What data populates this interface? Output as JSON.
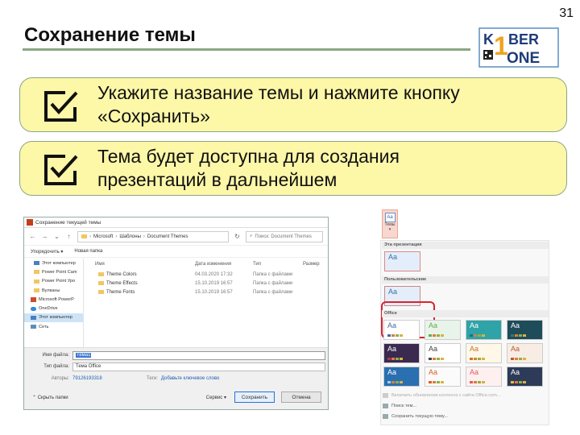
{
  "slide": {
    "number": "31",
    "title": "Сохранение темы"
  },
  "logo": {
    "line1": "KIBER",
    "line2": "ONE",
    "digit": "1"
  },
  "callouts": [
    {
      "line1": "Укажите название темы и нажмите кнопку",
      "line2": "«Сохранить»"
    },
    {
      "line1": "Тема будет доступна для создания",
      "line2": "презентаций в дальнейшем"
    }
  ],
  "dialog": {
    "title": "Сохранение текущей темы",
    "path": [
      "Microsoft",
      "Шаблоны",
      "Document Themes"
    ],
    "search_placeholder": "Поиск: Document Themes",
    "toolbar": {
      "organize": "Упорядочить ▾",
      "new_folder": "Новая папка"
    },
    "sidebar": [
      {
        "label": "Этот компьютер",
        "icon": "pc-icon"
      },
      {
        "label": "Power Point Cam",
        "icon": "folder-icon"
      },
      {
        "label": "Power Point Уро",
        "icon": "folder-icon"
      },
      {
        "label": "Вулканы",
        "icon": "folder-icon"
      },
      {
        "label": "Microsoft PowerP",
        "icon": "powerpoint-icon"
      },
      {
        "label": "OneDrive",
        "icon": "cloud-icon"
      },
      {
        "label": "Этот компьютер",
        "icon": "pc-icon",
        "selected": true
      },
      {
        "label": "Сеть",
        "icon": "network-icon"
      }
    ],
    "columns": {
      "name": "Имя",
      "date": "Дата изменения",
      "type": "Тип",
      "size": "Размер"
    },
    "files": [
      {
        "name": "Theme Colors",
        "date": "04.03.2020 17:32",
        "type": "Папка с файлами"
      },
      {
        "name": "Theme Effects",
        "date": "15.10.2019 16:57",
        "type": "Папка с файлами"
      },
      {
        "name": "Theme Fonts",
        "date": "15.10.2019 16:57",
        "type": "Папка с файлами"
      }
    ],
    "filename_label": "Имя файла:",
    "filename_value": "Тема1",
    "filetype_label": "Тип файла:",
    "filetype_value": "Тема Office",
    "authors_label": "Авторы:",
    "authors_value": "79126193318",
    "tags_label": "Теги:",
    "tags_value": "Добавьте ключевое слово",
    "hide_folders": "Скрыть папки",
    "service": "Сервис ▾",
    "save": "Сохранить",
    "cancel": "Отмена"
  },
  "themes_panel": {
    "button_label": "Темы",
    "aa": "Aa",
    "sections": {
      "current": "Эта презентация",
      "custom": "Пользовательские",
      "office": "Office"
    },
    "commands": {
      "refresh": "Включить обновления контента с сайта Office.com...",
      "browse": "Поиск тем...",
      "save": "Сохранить текущую тему..."
    },
    "office_theme_colors": [
      [
        "#ffffff",
        "#3b6ea5"
      ],
      [
        "#e8f4ea",
        "#6aa84f"
      ],
      [
        "#2ea3a8",
        "#1c6e8c"
      ],
      [
        "#1e4c5a",
        "#2e7d6e"
      ],
      [
        "#3b2a4f",
        "#b0335d"
      ],
      [
        "#ffffff",
        "#444444"
      ],
      [
        "#fff7e8",
        "#c07a2e"
      ],
      [
        "#f8ede4",
        "#b85c2c"
      ],
      [
        "#2a6fb0",
        "#9cd0f0"
      ],
      [
        "#fbfbfb",
        "#e25b22"
      ],
      [
        "#fff0f0",
        "#e25b5b"
      ],
      [
        "#2d3b59",
        "#f0b64b"
      ]
    ]
  }
}
